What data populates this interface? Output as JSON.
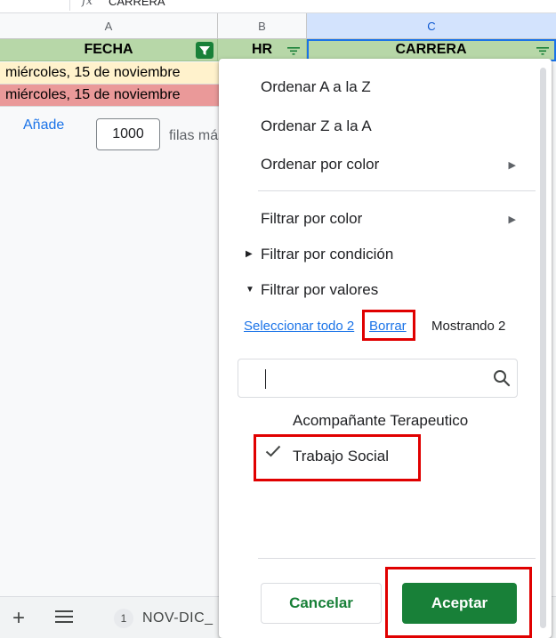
{
  "formula_bar": {
    "fx": "fx",
    "value": "CARRERA"
  },
  "columns": [
    {
      "letter": "A"
    },
    {
      "letter": "B"
    },
    {
      "letter": "C"
    }
  ],
  "header_row": {
    "fecha": "FECHA",
    "hr": "HR",
    "carrera": "CARRERA"
  },
  "rows": [
    {
      "fecha": "miércoles, 15 de noviembre",
      "color": "#fff2cc"
    },
    {
      "fecha": "miércoles, 15 de noviembre",
      "color": "#ea9999"
    }
  ],
  "add_rows": {
    "label": "Añade",
    "count": "1000",
    "suffix": "filas más"
  },
  "sheet_bar": {
    "badge": "1",
    "tab_name": "NOV-DIC_"
  },
  "filter_menu": {
    "sort_az": "Ordenar A a la Z",
    "sort_za": "Ordenar Z a la A",
    "sort_color": "Ordenar por color",
    "filter_color": "Filtrar por color",
    "filter_condition": "Filtrar por condición",
    "filter_values": "Filtrar por valores",
    "select_all": "Seleccionar todo 2",
    "clear": "Borrar",
    "showing": "Mostrando 2",
    "search_value": "",
    "values": [
      {
        "label": "Acompañante Terapeutico",
        "checked": false
      },
      {
        "label": "Trabajo Social",
        "checked": true
      }
    ],
    "cancel": "Cancelar",
    "ok": "Aceptar"
  },
  "colors": {
    "header_green": "#b7d7a8",
    "accent_green": "#188038",
    "link_blue": "#1a73e8",
    "highlight_red": "#e00000"
  }
}
